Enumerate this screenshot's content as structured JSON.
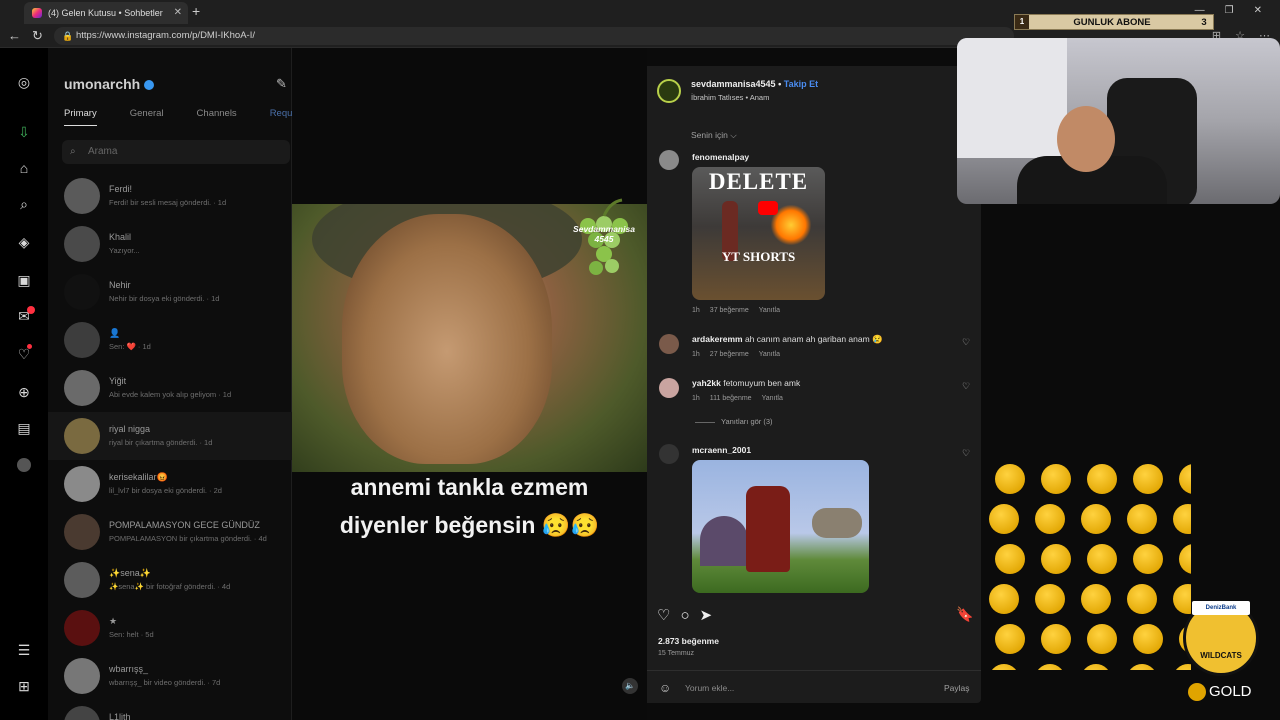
{
  "browser": {
    "tab_title": "(4) Gelen Kutusu • Sohbetler",
    "url": "https://www.instagram.com/p/DMI-IKhoA-I/",
    "new_tab_symbol": "+",
    "close_symbol": "✕"
  },
  "overlay": {
    "abone_rank": "1",
    "abone_label": "GUNLUK ABONE",
    "abone_count": "3",
    "gold_label": "GOLD",
    "wildcats_label": "WILDCATS",
    "wildcats_sponsor": "DenizBank"
  },
  "dm": {
    "username": "umonarchh",
    "tabs": [
      "Primary",
      "General",
      "Channels",
      "Requests"
    ],
    "search_placeholder": "Arama",
    "conversations": [
      {
        "name": "Ferdi!",
        "msg": "Ferdi! bir sesli mesaj gönderdi. · 1d"
      },
      {
        "name": "Khalil",
        "msg": "Yazıyor..."
      },
      {
        "name": "Nehir",
        "msg": "Nehir bir dosya eki gönderdi. · 1d"
      },
      {
        "name": "👤",
        "msg": "Sen: ❤️ · 1d"
      },
      {
        "name": "Yiğit",
        "msg": "Abi evde kalem yok alıp geliyom · 1d"
      },
      {
        "name": "riyal nigga",
        "msg": "riyal bir çıkartma gönderdi. · 1d"
      },
      {
        "name": "kerisekalilar😡",
        "msg": "lil_lvl7 bir dosya eki gönderdi. · 2d"
      },
      {
        "name": "POMPALAMASYON GECE GÜNDÜZ",
        "msg": "POMPALAMASYON bir çıkartma gönderdi. · 4d"
      },
      {
        "name": "✨sena✨",
        "msg": "✨sena✨ bir fotoğraf gönderdi. · 4d"
      },
      {
        "name": "★",
        "msg": "Sen: helt · 5d"
      },
      {
        "name": "wbarrışş_",
        "msg": "wbarrışş_ bir video gönderdi. · 7d"
      },
      {
        "name": "L1lith",
        "msg": ""
      }
    ]
  },
  "post": {
    "watermark": "Sevdammanisa 4545",
    "caption_line1": "annemi tankla ezmem",
    "caption_line2": "diyenler beğensin 😥😥",
    "author": "sevdammanisa4545",
    "separator": "•",
    "follow_label": "Takip Et",
    "music": "İbrahim Tatlıses • Anam",
    "for_you": "Senin için ⌵",
    "likes": "2.873 beğenme",
    "date": "15 Temmuz",
    "add_comment_placeholder": "Yorum ekle...",
    "share_label": "Paylaş",
    "see_replies": "Yanıtları gör (3)"
  },
  "comments": [
    {
      "user": "fenomenalpay",
      "text": "",
      "time": "1h",
      "likes": "37 beğenme",
      "reply": "Yanıtla",
      "image_text1": "DELETE",
      "image_text2": "YT SHORTS"
    },
    {
      "user": "ardakeremm",
      "text": "ah canım anam ah gariban anam 😢",
      "time": "1h",
      "likes": "27 beğenme",
      "reply": "Yanıtla"
    },
    {
      "user": "yah2kk",
      "text": "fetomuyum ben amk",
      "time": "1h",
      "likes": "111 beğenme",
      "reply": "Yanıtla"
    },
    {
      "user": "mcraenn_2001",
      "text": "",
      "time": "",
      "likes": "",
      "reply": ""
    }
  ]
}
